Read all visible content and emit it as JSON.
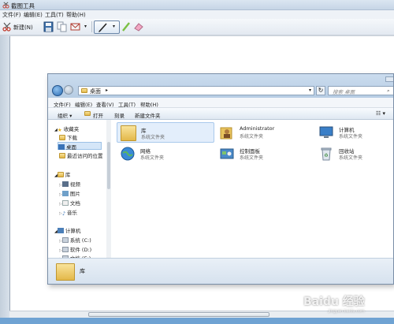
{
  "snip": {
    "title": "截图工具",
    "menu": [
      "文件(F)",
      "编辑(E)",
      "工具(T)",
      "帮助(H)"
    ],
    "toolbar": {
      "new_label": "新建(N)"
    }
  },
  "explorer": {
    "address": "桌面",
    "search_placeholder": "搜索 桌面",
    "menu": [
      "文件(F)",
      "编辑(E)",
      "查看(V)",
      "工具(T)",
      "帮助(H)"
    ],
    "commands": [
      "组织 ▾",
      "打开",
      "刻录",
      "新建文件夹"
    ],
    "nav": {
      "favorites": "收藏夹",
      "downloads": "下载",
      "desktop": "桌面",
      "recent": "最近访问的位置",
      "libraries": "库",
      "videos": "视频",
      "pictures": "图片",
      "documents": "文档",
      "music": "音乐",
      "computer": "计算机",
      "drive_c": "系统 (C:)",
      "drive_d": "软件 (D:)",
      "drive_e": "文档 (E:)"
    },
    "items": [
      {
        "name": "库",
        "type": "系统文件夹"
      },
      {
        "name": "Administrator",
        "type": "系统文件夹"
      },
      {
        "name": "计算机",
        "type": "系统文件夹"
      },
      {
        "name": "网络",
        "type": "系统文件夹"
      },
      {
        "name": "控制面板",
        "type": "系统文件夹"
      },
      {
        "name": "回收站",
        "type": "系统文件夹"
      }
    ],
    "details_label": "库"
  },
  "watermark": {
    "brand": "Baidu 经验",
    "url": "jingyan.baidu.com"
  }
}
